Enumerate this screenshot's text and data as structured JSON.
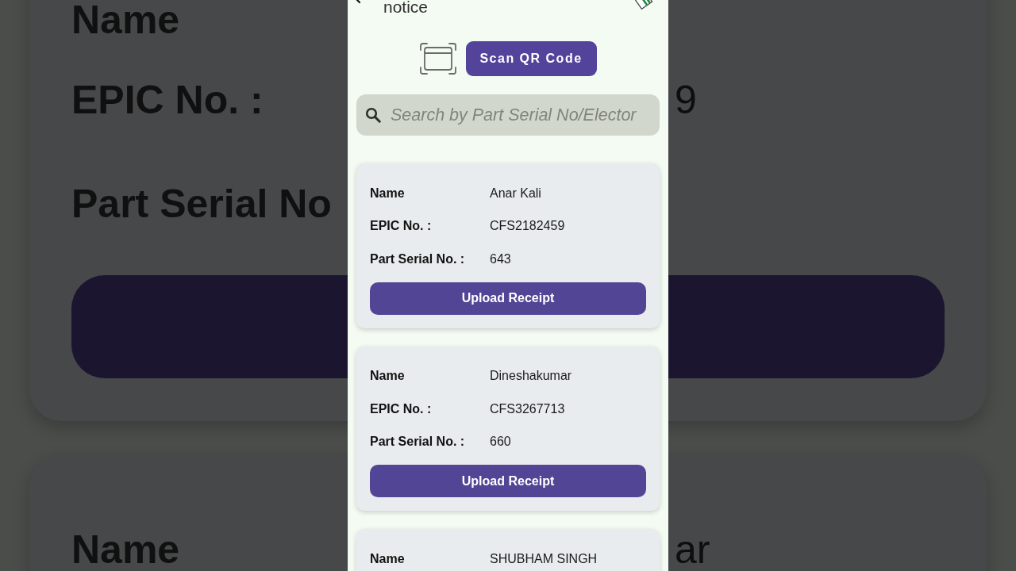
{
  "backdrop": {
    "cards": [
      {
        "fields": [
          {
            "label": "Name"
          },
          {
            "label": "EPIC No. :",
            "value": "9"
          },
          {
            "label": "Part Serial No"
          }
        ],
        "button_bar": true
      },
      {
        "fields": [
          {
            "label": "Name",
            "value": "ar"
          }
        ]
      }
    ]
  },
  "screen": {
    "header": {
      "title": "notice"
    },
    "scan_button": {
      "label": "Scan QR Code"
    },
    "search": {
      "placeholder": "Search by Part Serial No/Elector"
    },
    "voters": [
      {
        "fields": [
          {
            "label": "Name",
            "value": "Anar Kali"
          },
          {
            "label": "EPIC No. :",
            "value": "CFS2182459"
          },
          {
            "label": "Part Serial No. :",
            "value": "643"
          }
        ],
        "button": "Upload Receipt"
      },
      {
        "fields": [
          {
            "label": "Name",
            "value": "Dineshakumar"
          },
          {
            "label": "EPIC No. :",
            "value": "CFS3267713"
          },
          {
            "label": "Part Serial No. :",
            "value": "660"
          }
        ],
        "button": "Upload Receipt"
      },
      {
        "fields": [
          {
            "label": "Name",
            "value": "SHUBHAM SINGH"
          }
        ]
      }
    ]
  }
}
